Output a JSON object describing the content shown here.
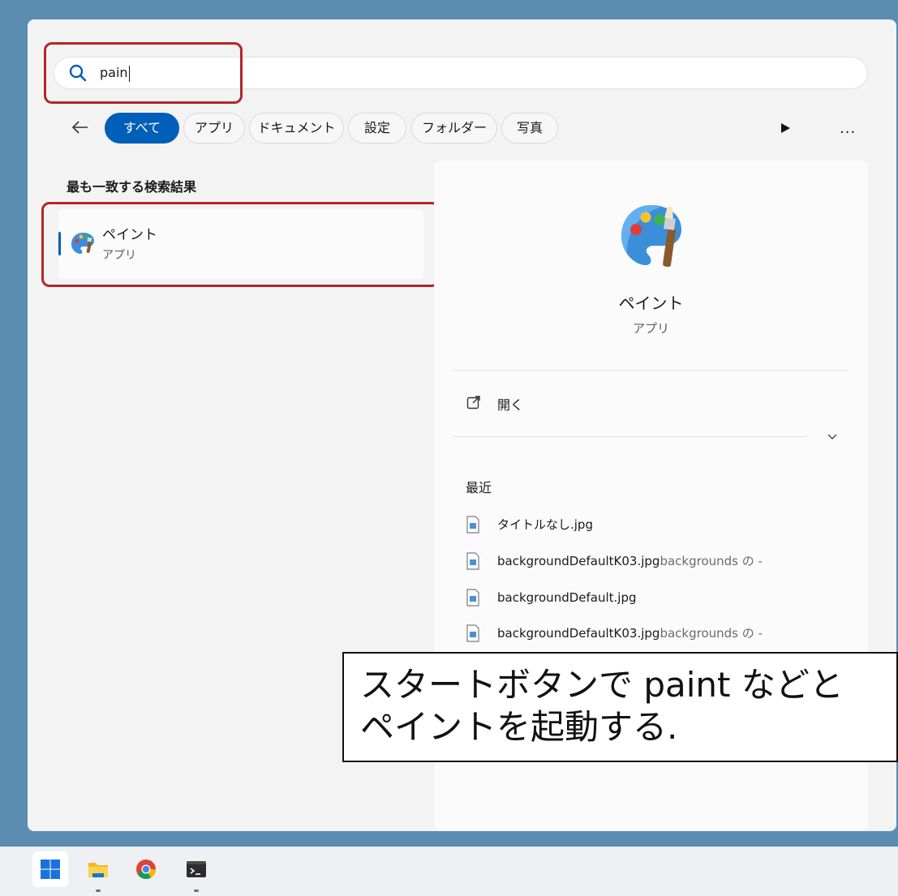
{
  "search": {
    "query": "pain"
  },
  "filters": {
    "items": [
      "すべて",
      "アプリ",
      "ドキュメント",
      "設定",
      "フォルダー",
      "写真"
    ],
    "overflow": "..."
  },
  "best_match": {
    "title": "最も一致する検索結果",
    "name": "ペイント",
    "type": "アプリ"
  },
  "detail": {
    "name": "ペイント",
    "type": "アプリ",
    "open_label": "開く",
    "recent_title": "最近",
    "recent": [
      {
        "name": "タイトルなし.jpg",
        "location": ""
      },
      {
        "name": "backgroundDefaultK03.jpg",
        "location": "backgrounds の -"
      },
      {
        "name": "backgroundDefault.jpg",
        "location": ""
      },
      {
        "name": "backgroundDefaultK03.jpg",
        "location": "backgrounds の -"
      }
    ]
  },
  "annotation": {
    "line1": "スタートボタンで paint などと",
    "line2": "ペイントを起動する."
  },
  "colors": {
    "accent": "#005fb8",
    "highlight": "#b3262a",
    "desktop": "#5b8db3"
  }
}
